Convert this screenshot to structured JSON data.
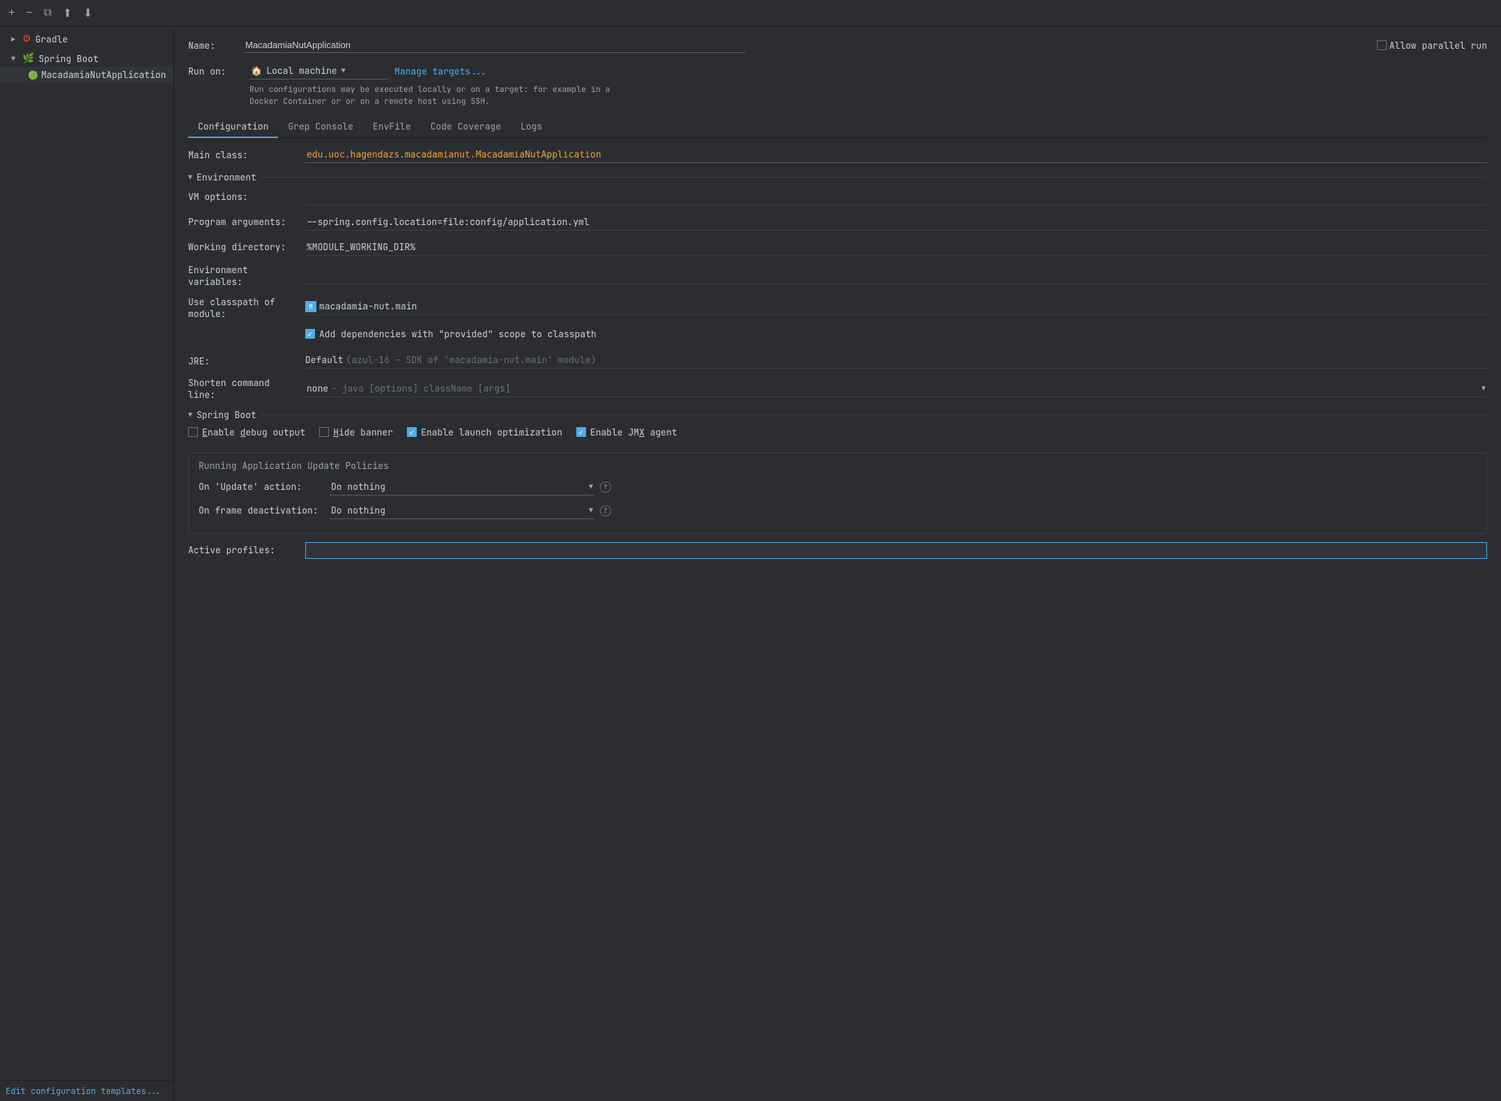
{
  "toolbar": {
    "add_label": "+",
    "remove_label": "−",
    "copy_label": "⧉",
    "move_up_label": "↑",
    "move_down_label": "↓"
  },
  "sidebar": {
    "groups": [
      {
        "label": "Gradle",
        "icon": "gradle-icon",
        "expanded": true,
        "items": []
      },
      {
        "label": "Spring Boot",
        "icon": "spring-icon",
        "expanded": true,
        "items": [
          {
            "label": "MacadamiaNutApplication",
            "icon": "app-icon"
          }
        ]
      }
    ],
    "footer_link": "Edit configuration templates..."
  },
  "form": {
    "name_label": "Name:",
    "name_value": "MacadamiaNutApplication",
    "parallel_checkbox_label": "Allow parallel run",
    "runon_label": "Run on:",
    "runon_value": "Local machine",
    "runon_icon": "🏠",
    "manage_targets_link": "Manage targets...",
    "runon_hint": "Run configurations may be executed locally or on a target: for example in a Docker Container or or on a remote host using SSH.",
    "tabs": [
      {
        "label": "Configuration",
        "active": true
      },
      {
        "label": "Grep Console",
        "active": false
      },
      {
        "label": "EnvFile",
        "active": false
      },
      {
        "label": "Code Coverage",
        "active": false
      },
      {
        "label": "Logs",
        "active": false
      }
    ],
    "main_class_label": "Main class:",
    "main_class_value": "edu.uoc.hagendazs.macadamianut.MacadamiaNutApplication",
    "environment_section": "Environment",
    "vm_options_label": "VM options:",
    "vm_options_value": "",
    "program_args_label": "Program arguments:",
    "program_args_value": "--spring.config.location=file:config/application.yml",
    "working_dir_label": "Working directory:",
    "working_dir_value": "%MODULE_WORKING_DIR%",
    "env_vars_label": "Environment variables:",
    "env_vars_value": "",
    "classpath_label": "Use classpath of module:",
    "classpath_value": "macadamia-nut.main",
    "add_deps_label": "Add dependencies with \"provided\" scope to classpath",
    "add_deps_checked": true,
    "jre_label": "JRE:",
    "jre_default": "Default",
    "jre_detail": "(azul-16 – SDK of 'macadamia-nut.main' module)",
    "shorten_label": "Shorten command line:",
    "shorten_value": "none",
    "shorten_detail": "- java [options] className [args]",
    "spring_boot_section": "Spring Boot",
    "enable_debug_label": "Enable debug output",
    "enable_debug_checked": false,
    "hide_banner_label": "Hide banner",
    "hide_banner_checked": false,
    "enable_launch_label": "Enable launch optimization",
    "enable_launch_checked": true,
    "enable_jmx_label": "Enable JMX agent",
    "enable_jmx_checked": true,
    "running_policies_title": "Running Application Update Policies",
    "on_update_label": "On 'Update' action:",
    "on_update_value": "Do nothing",
    "on_frame_label": "On frame deactivation:",
    "on_frame_value": "Do nothing",
    "active_profiles_label": "Active profiles:",
    "active_profiles_value": ""
  }
}
